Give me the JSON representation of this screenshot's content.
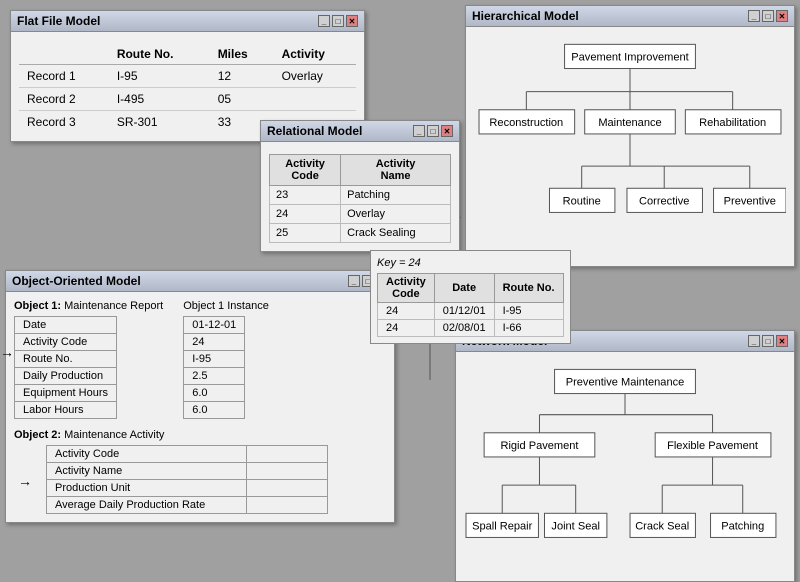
{
  "flatFile": {
    "title": "Flat File Model",
    "columns": [
      "Route No.",
      "Miles",
      "Activity"
    ],
    "rows": [
      {
        "label": "Record 1",
        "route": "I-95",
        "miles": "12",
        "activity": "Overlay"
      },
      {
        "label": "Record 2",
        "route": "I-495",
        "miles": "05",
        "activity": ""
      },
      {
        "label": "Record 3",
        "route": "SR-301",
        "miles": "33",
        "activity": ""
      }
    ]
  },
  "hierarchical": {
    "title": "Hierarchical Model",
    "nodes": {
      "root": "Pavement Improvement",
      "level1": [
        "Reconstruction",
        "Maintenance",
        "Rehabilitation"
      ],
      "level2": [
        "Routine",
        "Corrective",
        "Preventive"
      ]
    }
  },
  "relational": {
    "title": "Relational Model",
    "columns": [
      "Activity Code",
      "Activity Name"
    ],
    "rows": [
      {
        "code": "23",
        "name": "Patching"
      },
      {
        "code": "24",
        "name": "Overlay"
      },
      {
        "code": "25",
        "name": "Crack Sealing"
      }
    ]
  },
  "keyLookup": {
    "keyLabel": "Key = 24",
    "columns": [
      "Activity Code",
      "Date",
      "Route No."
    ],
    "rows": [
      {
        "code": "24",
        "date": "01/12/01",
        "route": "I-95"
      },
      {
        "code": "24",
        "date": "02/08/01",
        "route": "I-66"
      }
    ]
  },
  "ooModel": {
    "title": "Object-Oriented Model",
    "object1": {
      "label": "Object 1:",
      "name": "Maintenance Report",
      "fields": [
        "Date",
        "Activity Code",
        "Route No.",
        "Daily Production",
        "Equipment Hours",
        "Labor Hours"
      ],
      "instanceLabel": "Object 1 Instance",
      "values": [
        "01-12-01",
        "24",
        "I-95",
        "2.5",
        "6.0",
        "6.0"
      ]
    },
    "object2": {
      "label": "Object 2:",
      "name": "Maintenance Activity",
      "fields": [
        "Activity Code",
        "Activity Name",
        "Production Unit",
        "Average Daily Production Rate"
      ]
    }
  },
  "network": {
    "title": "Network Model",
    "nodes": {
      "root": "Preventive Maintenance",
      "level1": [
        "Rigid Pavement",
        "Flexible Pavement"
      ],
      "level2": [
        "Spall Repair",
        "Joint Seal",
        "Crack Seal",
        "Patching"
      ]
    }
  },
  "windowControls": {
    "minimize": "_",
    "maximize": "□",
    "close": "✕"
  },
  "colors": {
    "titlebar": "#c8d0e0",
    "border": "#888888",
    "nodeBackground": "#ffffff",
    "tableBorder": "#999999"
  }
}
